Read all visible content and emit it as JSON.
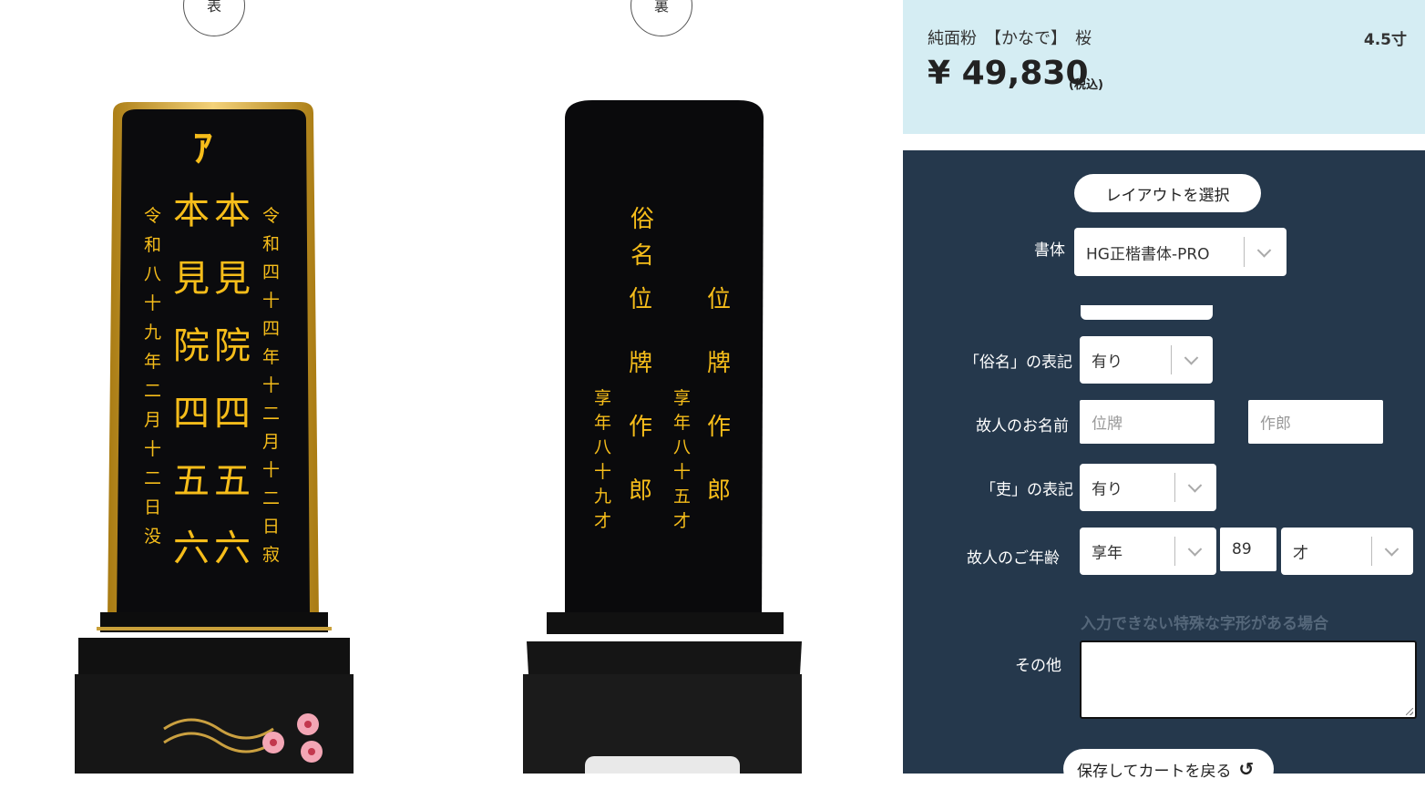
{
  "preview": {
    "front_label": "表",
    "back_label": "裏",
    "front": {
      "bonji": "ｱ",
      "left_col": [
        "令",
        "和",
        "八",
        "十",
        "九",
        "年",
        "二",
        "月",
        "十",
        "二",
        "日",
        "没"
      ],
      "mid_left_col": [
        "本",
        "見",
        "院",
        "四",
        "五",
        "六"
      ],
      "mid_right_col": [
        "本",
        "見",
        "院",
        "四",
        "五",
        "六"
      ],
      "right_col": [
        "令",
        "和",
        "四",
        "十",
        "四",
        "年",
        "十",
        "二",
        "月",
        "十",
        "二",
        "日",
        "寂"
      ]
    },
    "back": {
      "label_col": [
        "俗",
        "名"
      ],
      "name_col_1": [
        "位",
        "牌",
        "作",
        "郎"
      ],
      "name_col_2": [
        "位",
        "牌",
        "作",
        "郎"
      ],
      "age_col_1": [
        "享",
        "年",
        "八",
        "十",
        "九",
        "才"
      ],
      "age_col_2": [
        "享",
        "年",
        "八",
        "十",
        "五",
        "才"
      ]
    },
    "colors": {
      "gold": "#f6bd1a",
      "lacquer": "#0b0b0d"
    }
  },
  "product": {
    "name": "純面粉　【かなで】　桜",
    "size": "4.5寸",
    "price": "¥ 49,830",
    "tax": "(税込)"
  },
  "form": {
    "layout_button": "レイアウトを選択",
    "font_label": "書体",
    "font_value": "HG正楷書体-PRO",
    "zokumyo_label": "「俗名」の表記",
    "zokumyo_value": "有り",
    "name_label": "故人のお名前",
    "surname_placeholder": "位牌",
    "given_placeholder": "作郎",
    "ri_label": "「吏」の表記",
    "ri_value": "有り",
    "age_label": "故人のご年齢",
    "age_type": "享年",
    "age_number": "89",
    "age_unit": "才",
    "hint": "入力できない特殊な字形がある場合",
    "other_label": "その他",
    "save_button": "保存してカートを戻る"
  },
  "accent_colors": {
    "panel_bg": "#25384c",
    "header_bg": "#d5edf3"
  }
}
